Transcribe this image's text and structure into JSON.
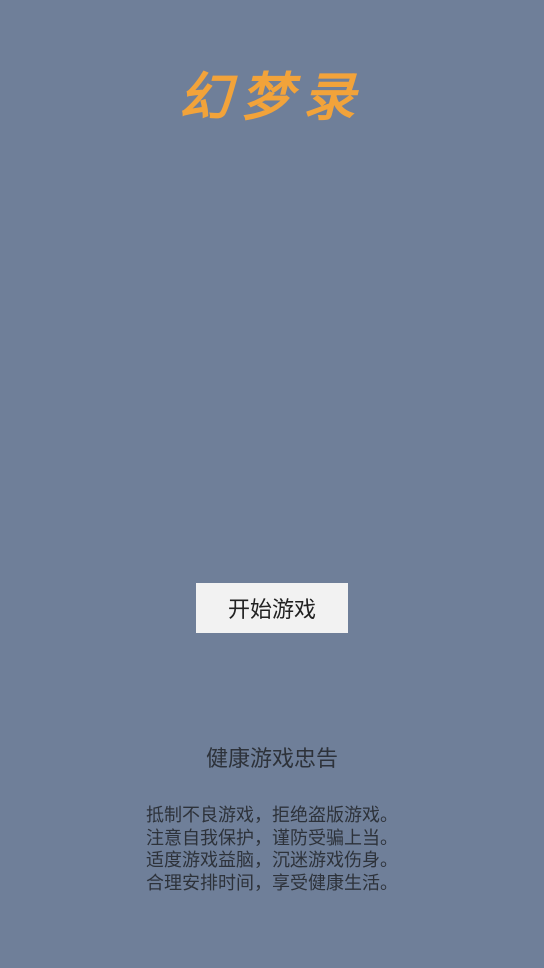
{
  "game": {
    "title": "幻梦录",
    "start_label": "开始游戏"
  },
  "health_notice": {
    "title": "健康游戏忠告",
    "lines": [
      "抵制不良游戏，拒绝盗版游戏。",
      "注意自我保护，谨防受骗上当。",
      "适度游戏益脑，沉迷游戏伤身。",
      "合理安排时间，享受健康生活。"
    ]
  },
  "colors": {
    "background": "#6f7f99",
    "title": "#f2a33a",
    "button_bg": "#f2f2f2",
    "text": "#2d323a"
  }
}
